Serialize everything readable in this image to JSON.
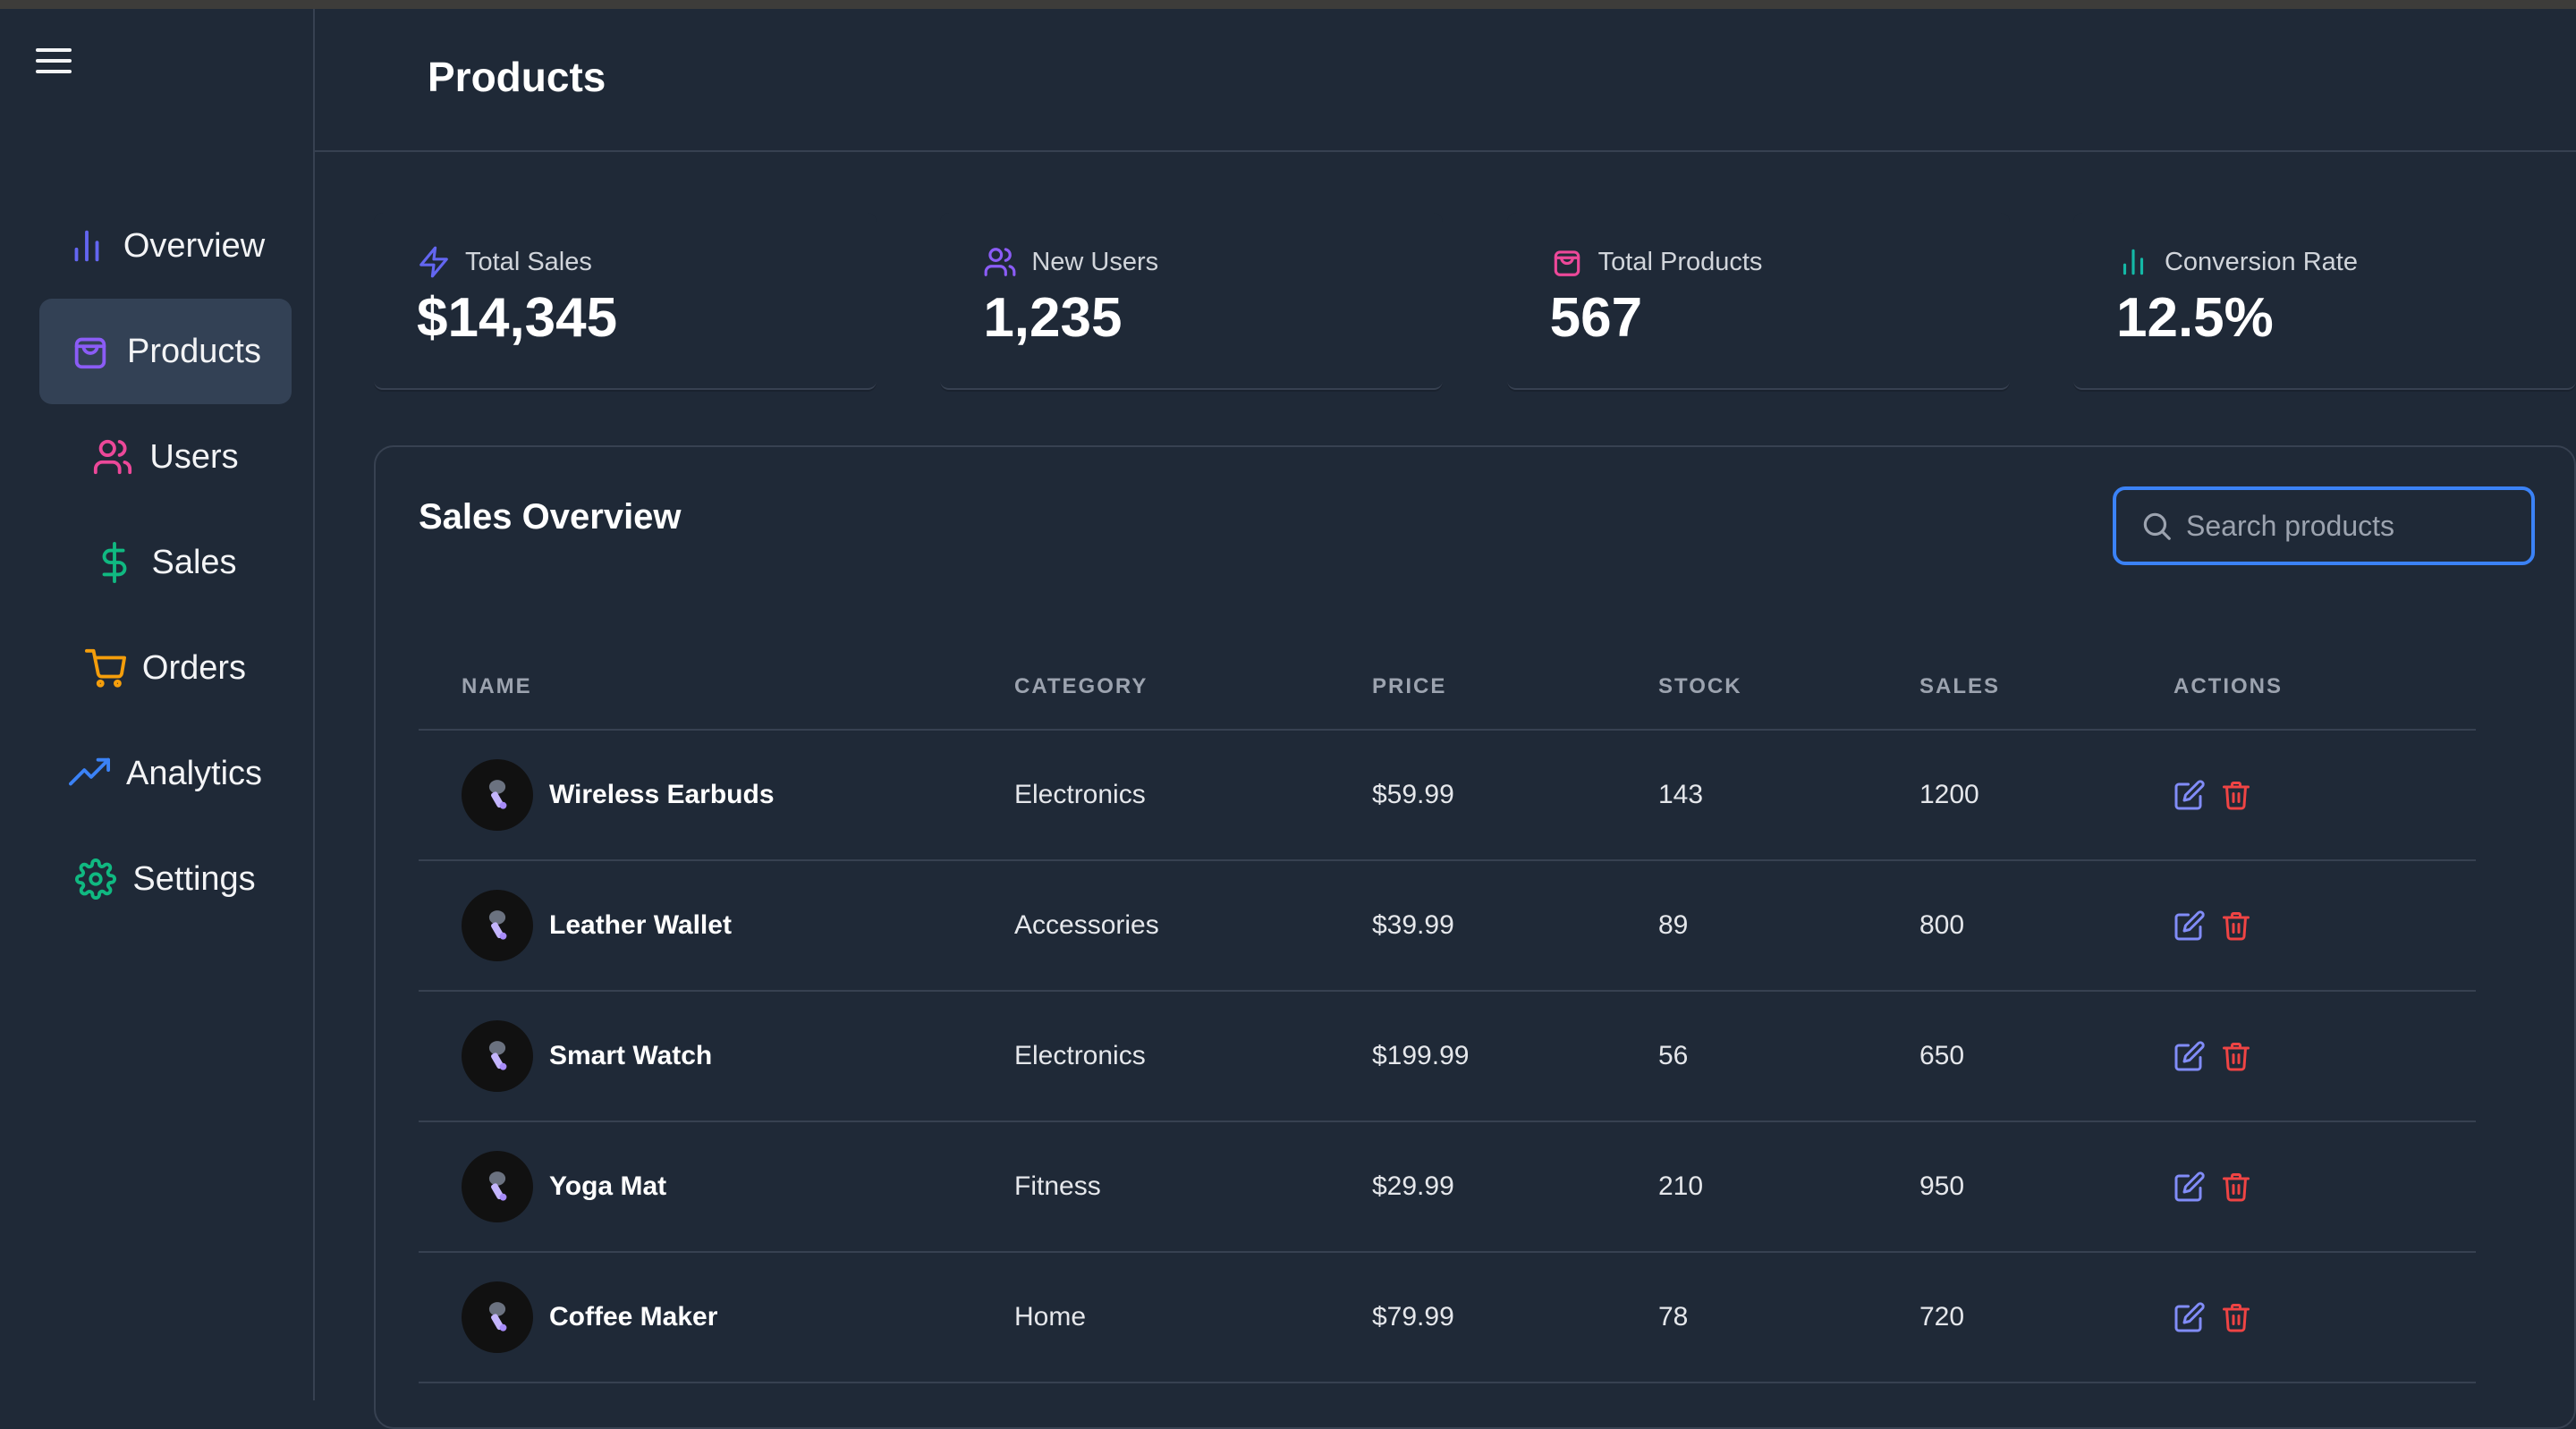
{
  "page_title": "Products",
  "colors": {
    "background": "#1f2937",
    "accent": "#3b82f6",
    "overview": "#6366f1",
    "products": "#8b5cf6",
    "users": "#ec4899",
    "sales": "#10b981",
    "orders": "#f59e0b",
    "analytics": "#3b82f6",
    "settings": "#10b981",
    "delete": "#ef4444"
  },
  "sidebar": {
    "menu_icon": "hamburger-icon",
    "items": [
      {
        "label": "Overview",
        "icon": "bar-chart-icon",
        "active": false
      },
      {
        "label": "Products",
        "icon": "shopping-bag-icon",
        "active": true
      },
      {
        "label": "Users",
        "icon": "users-icon",
        "active": false
      },
      {
        "label": "Sales",
        "icon": "dollar-icon",
        "active": false
      },
      {
        "label": "Orders",
        "icon": "cart-icon",
        "active": false
      },
      {
        "label": "Analytics",
        "icon": "trending-up-icon",
        "active": false
      },
      {
        "label": "Settings",
        "icon": "gear-icon",
        "active": false
      }
    ]
  },
  "stats": [
    {
      "label": "Total Sales",
      "value": "$14,345",
      "icon": "lightning-icon"
    },
    {
      "label": "New Users",
      "value": "1,235",
      "icon": "users-icon"
    },
    {
      "label": "Total Products",
      "value": "567",
      "icon": "shopping-bag-icon"
    },
    {
      "label": "Conversion Rate",
      "value": "12.5%",
      "icon": "bar-chart-icon"
    }
  ],
  "panel": {
    "title": "Sales Overview",
    "search_placeholder": "Search products",
    "columns": [
      "NAME",
      "CATEGORY",
      "PRICE",
      "STOCK",
      "SALES",
      "ACTIONS"
    ],
    "rows": [
      {
        "name": "Wireless Earbuds",
        "category": "Electronics",
        "price": "$59.99",
        "stock": "143",
        "sales": "1200"
      },
      {
        "name": "Leather Wallet",
        "category": "Accessories",
        "price": "$39.99",
        "stock": "89",
        "sales": "800"
      },
      {
        "name": "Smart Watch",
        "category": "Electronics",
        "price": "$199.99",
        "stock": "56",
        "sales": "650"
      },
      {
        "name": "Yoga Mat",
        "category": "Fitness",
        "price": "$29.99",
        "stock": "210",
        "sales": "950"
      },
      {
        "name": "Coffee Maker",
        "category": "Home",
        "price": "$79.99",
        "stock": "78",
        "sales": "720"
      }
    ]
  }
}
